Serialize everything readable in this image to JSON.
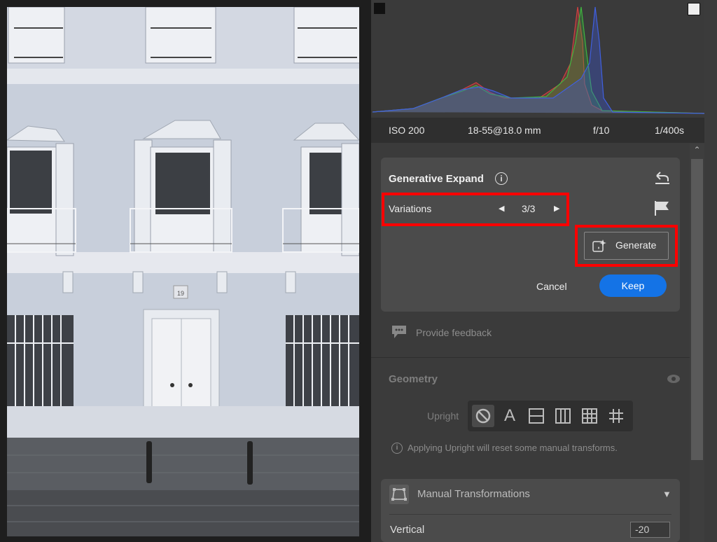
{
  "photo": {
    "house_number": "19"
  },
  "exif": {
    "iso": "ISO 200",
    "lens": "18-55@18.0 mm",
    "aperture": "f/10",
    "shutter": "1/400s"
  },
  "generative_expand": {
    "title": "Generative Expand",
    "variations_label": "Variations",
    "variation_counter": "3/3",
    "generate_label": "Generate",
    "cancel_label": "Cancel",
    "keep_label": "Keep"
  },
  "feedback": {
    "label": "Provide feedback"
  },
  "geometry": {
    "title": "Geometry",
    "upright_label": "Upright",
    "upright_note": "Applying Upright will reset some manual transforms."
  },
  "manual_transformations": {
    "title": "Manual Transformations",
    "vertical_label": "Vertical",
    "vertical_value": "-20"
  },
  "colors": {
    "accent": "#1473e6",
    "highlight": "#ff0000",
    "panel": "#3b3b3b",
    "card": "#4b4b4b"
  },
  "icons": [
    "info-icon",
    "undo-icon",
    "flag-icon",
    "prev-arrow-icon",
    "next-arrow-icon",
    "generate-sparkle-icon",
    "feedback-icon",
    "eye-icon",
    "no-upright-icon",
    "auto-upright-icon",
    "level-icon",
    "vertical-icon",
    "full-icon",
    "guided-icon",
    "transform-icon",
    "collapse-icon",
    "scroll-up-icon"
  ]
}
